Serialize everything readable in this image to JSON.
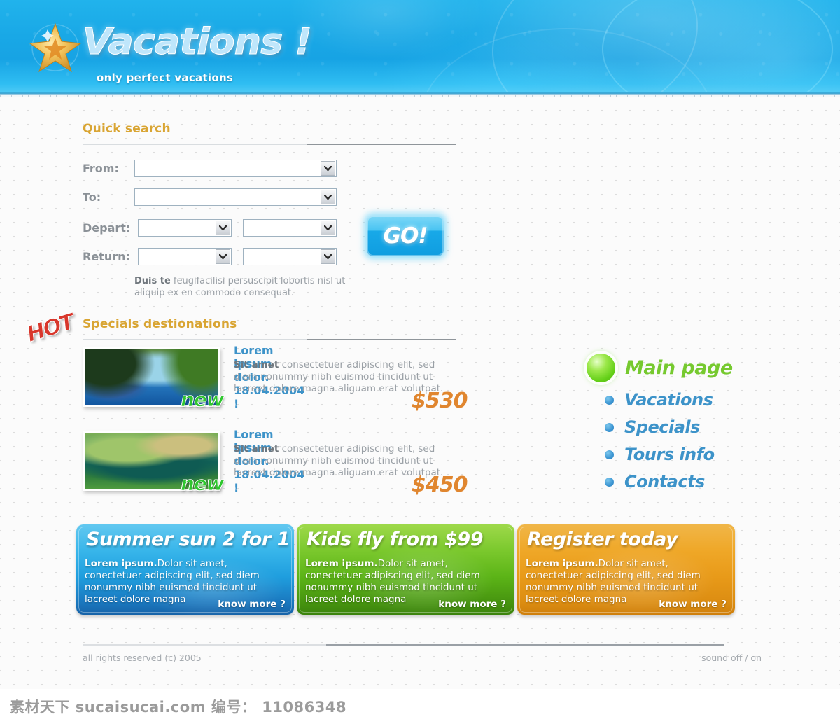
{
  "header": {
    "logo_title": "Vacations !",
    "tagline": "only perfect vacations",
    "starfish_icon": "starfish-icon"
  },
  "quick_search": {
    "title": "Quick search",
    "labels": {
      "from": "From:",
      "to": "To:",
      "depart": "Depart:",
      "return": "Return:"
    },
    "fields": {
      "from_value": "",
      "to_value": "",
      "depart_day_value": "",
      "depart_month_value": "",
      "return_day_value": "",
      "return_month_value": ""
    },
    "go_label": "GO!",
    "note_bold": "Duis te",
    "note_rest": " feugifacilisi persuscipit lobortis nisl ut aliquip ex en commodo consequat."
  },
  "specials": {
    "title": "Specials destionations",
    "hot_badge": "HOT",
    "new_badge": "new",
    "items": [
      {
        "heading": "Lorem ipsum dolor. 18.04.2004 !",
        "body_bold": "Sit amet",
        "body_rest": " consectetuer adipiscing elit, sed diem nonummy nibh euismod tincidunt ut lacreet dolore magna aliguam erat volutpat.",
        "price": "$530",
        "badge": "new"
      },
      {
        "heading": "Lorem ipsum dolor. 18.04.2004 !",
        "body_bold": "Sit amet",
        "body_rest": " consectetuer adipiscing elit, sed diem nonummy nibh euismod tincidunt ut lacreet dolore magna aliguam erat volutpat.",
        "price": "$450",
        "badge": "new"
      }
    ]
  },
  "nav": {
    "main_label": "Main page",
    "items": [
      {
        "label": "Vacations"
      },
      {
        "label": "Specials"
      },
      {
        "label": "Tours info"
      },
      {
        "label": "Contacts"
      }
    ]
  },
  "promos": [
    {
      "title": "Summer sun  2 for 1",
      "body_bold": "Lorem ipsum.",
      "body_rest": "Dolor sit amet, conectetuer adipiscing elit, sed diem nonummy nibh euismod tincidunt ut lacreet dolore magna",
      "more": "know more ?",
      "color": "#1f9ede"
    },
    {
      "title": "Kids fly from $99",
      "body_bold": "Lorem ipsum.",
      "body_rest": "Dolor sit amet, conectetuer adipiscing elit, sed diem nonummy nibh euismod tincidunt ut lacreet dolore magna",
      "more": "know more ?",
      "color": "#5cb417"
    },
    {
      "title": "Register today",
      "body_bold": "Lorem ipsum.",
      "body_rest": "Dolor sit amet, conectetuer adipiscing elit, sed diem nonummy nibh euismod tincidunt ut lacreet dolore magna",
      "more": "know more ?",
      "color": "#e89a19"
    }
  ],
  "footer": {
    "copyright": "all rights reserved (c) 2005",
    "sound_toggle": "sound off / on"
  },
  "watermark": {
    "text": "素材天下 sucaisucai.com  编号： 11086348"
  },
  "colors": {
    "header_blue": "#19a8e6",
    "section_title_gold": "#d9a533",
    "link_blue": "#3d93c9",
    "price_orange": "#e0862f",
    "new_green": "#2fc62f",
    "hot_red": "#d8372c",
    "main_page_green": "#76c92f"
  }
}
